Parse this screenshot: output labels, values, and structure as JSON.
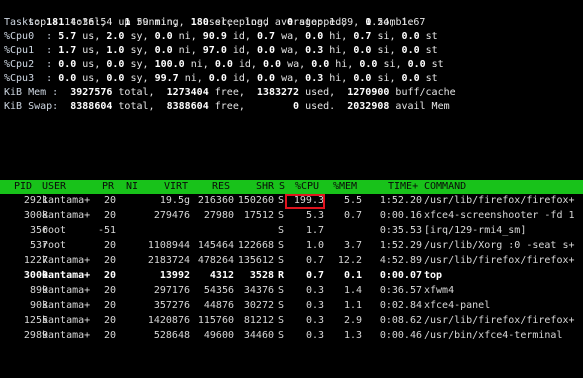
{
  "summary": {
    "top_line": "top - 14:36:54 up 59 min,  1 user,  load average: 1.89, 1.54, 1.67",
    "tasks_label": "Tasks:",
    "tasks_total": "181",
    "tasks_total_label": "total,",
    "tasks_running": "1",
    "tasks_running_label": "running,",
    "tasks_sleeping": "180",
    "tasks_sleeping_label": "sleeping,",
    "tasks_stopped": "0",
    "tasks_stopped_label": "stopped,",
    "tasks_zombie": "0",
    "tasks_zombie_label": "zombie",
    "cpus": [
      {
        "label": "%Cpu0  :",
        "us": "5.7",
        "sy": "2.0",
        "ni": "0.0",
        "id": "90.9",
        "wa": "0.7",
        "hi": "0.0",
        "si": "0.7",
        "st": "0.0"
      },
      {
        "label": "%Cpu1  :",
        "us": "1.7",
        "sy": "1.0",
        "ni": "0.0",
        "id": "97.0",
        "wa": "0.0",
        "hi": "0.3",
        "si": "0.0",
        "st": "0.0"
      },
      {
        "label": "%Cpu2  :",
        "us": "0.0",
        "sy": "0.0",
        "ni": "100.0",
        "id": "0.0",
        "wa": "0.0",
        "hi": "0.0",
        "si": "0.0",
        "st": "0.0"
      },
      {
        "label": "%Cpu3  :",
        "us": "0.0",
        "sy": "0.0",
        "ni": "99.7",
        "id": "0.0",
        "wa": "0.0",
        "hi": "0.3",
        "si": "0.0",
        "st": "0.0"
      }
    ],
    "mem_label": "KiB Mem :",
    "mem_total": "3927576",
    "mem_free": "1273404",
    "mem_used": "1383272",
    "mem_cache": "1270900",
    "mem_cache_label": "buff/cache",
    "swap_label": "KiB Swap:",
    "swap_total": "8388604",
    "swap_free": "8388604",
    "swap_used": "0",
    "swap_avail": "2032908",
    "swap_avail_label": "avail Mem"
  },
  "table": {
    "headers": [
      "PID",
      "USER",
      "PR",
      "NI",
      "VIRT",
      "RES",
      "SHR",
      "S",
      "%CPU",
      "%MEM",
      "TIME+",
      "COMMAND"
    ],
    "rows": [
      {
        "pid": "2921",
        "user": "kantama+",
        "pr": "20",
        "ni": "",
        "virt": "19.5g",
        "res": "216360",
        "shr": "150260",
        "s": "S",
        "cpu": "199.3",
        "mem": "5.5",
        "time": "1:52.20",
        "cmd": "/usr/lib/firefox/firefox+",
        "bold": false
      },
      {
        "pid": "3008",
        "user": "kantama+",
        "pr": "20",
        "ni": "",
        "virt": "279476",
        "res": "27980",
        "shr": "17512",
        "s": "S",
        "cpu": "5.3",
        "mem": "0.7",
        "time": "0:00.16",
        "cmd": "xfce4-screenshooter -fd 1",
        "bold": false
      },
      {
        "pid": "356",
        "user": "root",
        "pr": "-51",
        "ni": "",
        "virt": "",
        "res": "",
        "shr": "",
        "s": "S",
        "cpu": "1.7",
        "mem": "",
        "time": "0:35.53",
        "cmd": "[irq/129-rmi4_sm]",
        "bold": false
      },
      {
        "pid": "537",
        "user": "root",
        "pr": "20",
        "ni": "",
        "virt": "1108944",
        "res": "145464",
        "shr": "122668",
        "s": "S",
        "cpu": "1.0",
        "mem": "3.7",
        "time": "1:52.29",
        "cmd": "/usr/lib/Xorg :0 -seat s+",
        "bold": false
      },
      {
        "pid": "1227",
        "user": "kantama+",
        "pr": "20",
        "ni": "",
        "virt": "2183724",
        "res": "478264",
        "shr": "135612",
        "s": "S",
        "cpu": "0.7",
        "mem": "12.2",
        "time": "4:52.89",
        "cmd": "/usr/lib/firefox/firefox+",
        "bold": false
      },
      {
        "pid": "3000",
        "user": "kantama+",
        "pr": "20",
        "ni": "",
        "virt": "13992",
        "res": "4312",
        "shr": "3528",
        "s": "R",
        "cpu": "0.7",
        "mem": "0.1",
        "time": "0:00.07",
        "cmd": "top",
        "bold": true
      },
      {
        "pid": "899",
        "user": "kantama+",
        "pr": "20",
        "ni": "",
        "virt": "297176",
        "res": "54356",
        "shr": "34376",
        "s": "S",
        "cpu": "0.3",
        "mem": "1.4",
        "time": "0:36.57",
        "cmd": "xfwm4",
        "bold": false
      },
      {
        "pid": "903",
        "user": "kantama+",
        "pr": "20",
        "ni": "",
        "virt": "357276",
        "res": "44876",
        "shr": "30272",
        "s": "S",
        "cpu": "0.3",
        "mem": "1.1",
        "time": "0:02.84",
        "cmd": "xfce4-panel",
        "bold": false
      },
      {
        "pid": "1255",
        "user": "kantama+",
        "pr": "20",
        "ni": "",
        "virt": "1420876",
        "res": "115760",
        "shr": "81212",
        "s": "S",
        "cpu": "0.3",
        "mem": "2.9",
        "time": "0:08.62",
        "cmd": "/usr/lib/firefox/firefox+",
        "bold": false
      },
      {
        "pid": "2989",
        "user": "kantama+",
        "pr": "20",
        "ni": "",
        "virt": "528648",
        "res": "49600",
        "shr": "34460",
        "s": "S",
        "cpu": "0.3",
        "mem": "1.3",
        "time": "0:00.46",
        "cmd": "/usr/bin/xfce4-terminal",
        "bold": false
      }
    ]
  },
  "colors": {
    "header_bar": "#18c21a",
    "highlight_box": "#e0141e",
    "background": "#000000"
  }
}
